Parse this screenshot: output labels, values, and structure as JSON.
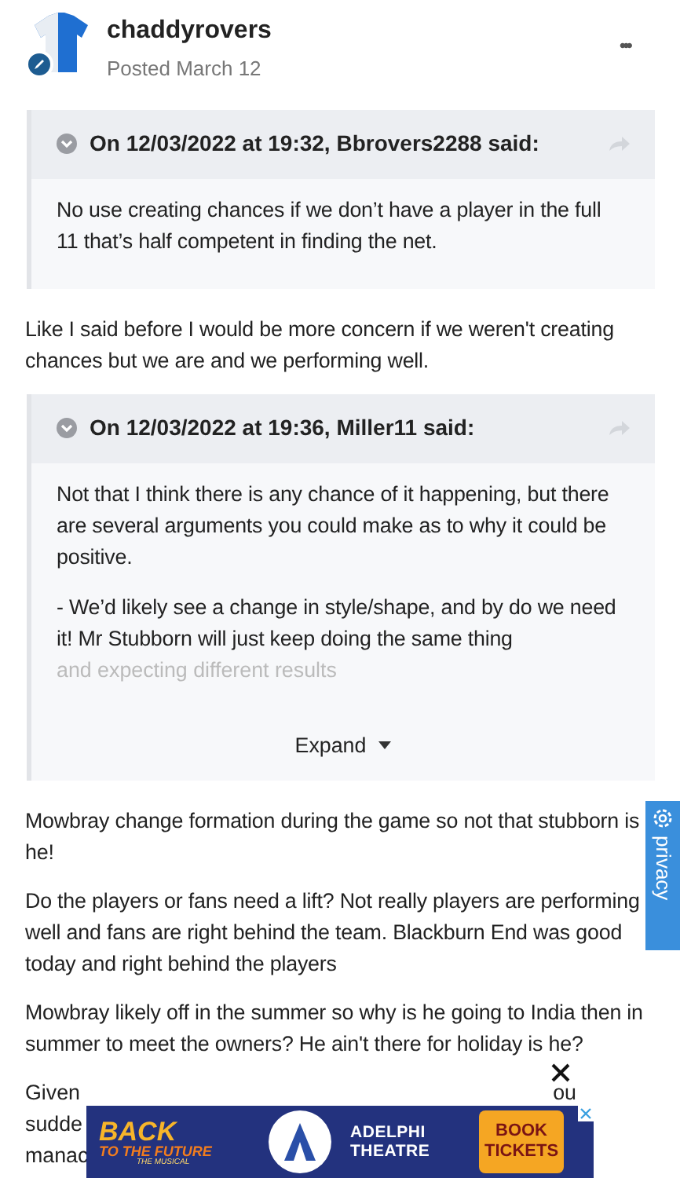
{
  "post": {
    "author": "chaddyrovers",
    "posted": "Posted March 12",
    "menu": "•••"
  },
  "blocks": [
    {
      "kind": "quote",
      "header": "On 12/03/2022 at 19:32, Bbrovers2288 said:",
      "paragraphs": [
        "No use creating chances if we don’t have a player in the full 11 that’s half competent in finding the net."
      ]
    },
    {
      "kind": "text",
      "text": "Like I said before I would be more concern if we weren't creating chances but we are and we performing well."
    },
    {
      "kind": "quote",
      "header": "On 12/03/2022 at 19:36, Miller11 said:",
      "paragraphs": [
        "Not that I think there is any chance of it happening, but there are several arguments you could make as to why it could be positive.",
        "- We’d likely see a change in style/shape, and by do we need it! Mr Stubborn will just keep doing the same thing"
      ],
      "faded": "and expecting different results",
      "expand": "Expand"
    },
    {
      "kind": "text",
      "text": "Mowbray change formation during the game so not that stubborn is he!"
    },
    {
      "kind": "text",
      "text": "Do the players or fans need a lift? Not really players are performing well and fans are right behind the team. Blackburn End was good today and right behind the players"
    },
    {
      "kind": "text",
      "text": "Mowbray likely off in the summer so why is he going to India then in summer to meet the owners? He ain't there for holiday is he?"
    }
  ],
  "partial_lines": [
    {
      "left": "Given",
      "right": "ou"
    },
    {
      "left": "sudde"
    },
    {
      "left": "manac"
    }
  ],
  "privacy_tab": "privacy",
  "ad": {
    "logo_top": "BACK",
    "logo_middle": "TO THE FUTURE",
    "logo_bottom": "THE MUSICAL",
    "venue": "ADELPHI THEATRE",
    "cta": "BOOK TICKETS"
  }
}
